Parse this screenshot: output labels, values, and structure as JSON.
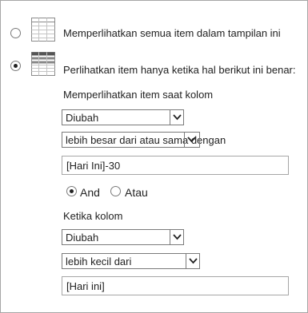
{
  "options": {
    "show_all_label": "Memperlihatkan semua item dalam tampilan ini",
    "show_filtered_label": "Perlihatkan item hanya ketika hal berikut ini benar:"
  },
  "filter1": {
    "column_label": "Memperlihatkan item saat kolom",
    "column_value": "Diubah",
    "operator_value": "lebih besar dari atau sama dengan",
    "value": "[Hari Ini]-30"
  },
  "logic": {
    "and_label": "And",
    "or_label": "Atau",
    "selected": "And"
  },
  "filter2": {
    "column_label": "Ketika kolom",
    "column_value": "Diubah",
    "operator_value": "lebih kecil dari",
    "value": "[Hari ini]"
  }
}
